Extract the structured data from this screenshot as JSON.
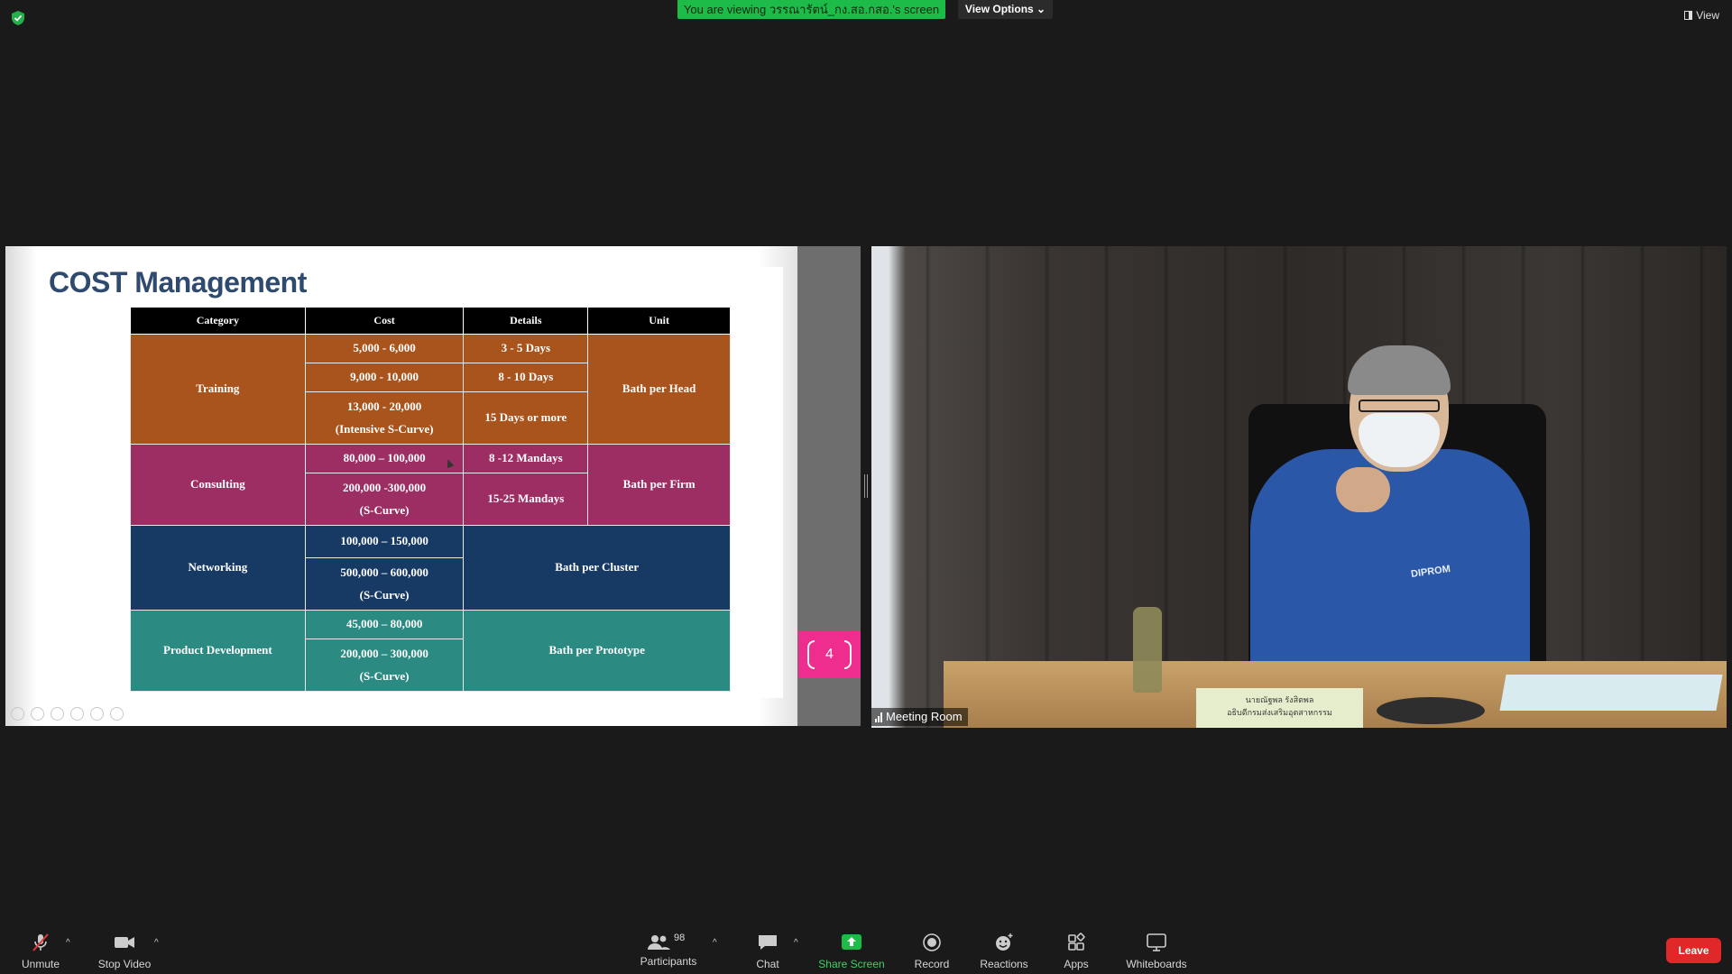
{
  "top": {
    "viewing_banner": "You are viewing วรรณารัตน์_กง.สอ.กสอ.'s screen",
    "view_options": "View Options ⌄",
    "view": "View"
  },
  "slide": {
    "title": "COST Management",
    "page_badge": "4",
    "headers": [
      "Category",
      "Cost",
      "Details",
      "Unit"
    ],
    "rows": {
      "training": {
        "category": "Training",
        "costs": [
          "5,000 - 6,000",
          "9,000 - 10,000",
          "13,000 - 20,000",
          "(Intensive S-Curve)"
        ],
        "details": [
          "3 - 5 Days",
          "8 - 10 Days",
          "15 Days or more"
        ],
        "unit": "Bath per Head"
      },
      "consulting": {
        "category": "Consulting",
        "costs": [
          "80,000 – 100,000",
          "200,000 -300,000",
          "(S-Curve)"
        ],
        "details": [
          "8 -12 Mandays",
          "15-25 Mandays"
        ],
        "unit": "Bath per Firm"
      },
      "networking": {
        "category": "Networking",
        "costs": [
          "100,000 – 150,000",
          "500,000 – 600,000",
          "(S-Curve)"
        ],
        "unit": "Bath per Cluster"
      },
      "product": {
        "category": "Product Development",
        "costs": [
          "45,000 – 80,000",
          "200,000 – 300,000",
          "(S-Curve)"
        ],
        "unit": "Bath per Prototype"
      }
    }
  },
  "video": {
    "tile_label": "Meeting Room",
    "nameplate_line1": "นายณัฐพล รังสิตพล",
    "nameplate_line2": "อธิบดีกรมส่งเสริมอุตสาหกรรม",
    "shirt_logo": "DIPROM"
  },
  "toolbar": {
    "unmute": "Unmute",
    "stop_video": "Stop Video",
    "participants": "Participants",
    "participants_count": "98",
    "chat": "Chat",
    "share_screen": "Share Screen",
    "record": "Record",
    "reactions": "Reactions",
    "apps": "Apps",
    "whiteboards": "Whiteboards",
    "leave": "Leave"
  },
  "colors": {
    "share_green": "#1dbb48",
    "leave_red": "#e02828",
    "training": "#a8541c",
    "consulting": "#9c2e64",
    "networking": "#163a64",
    "product": "#2b8a82",
    "page_badge": "#ef2d8e"
  }
}
